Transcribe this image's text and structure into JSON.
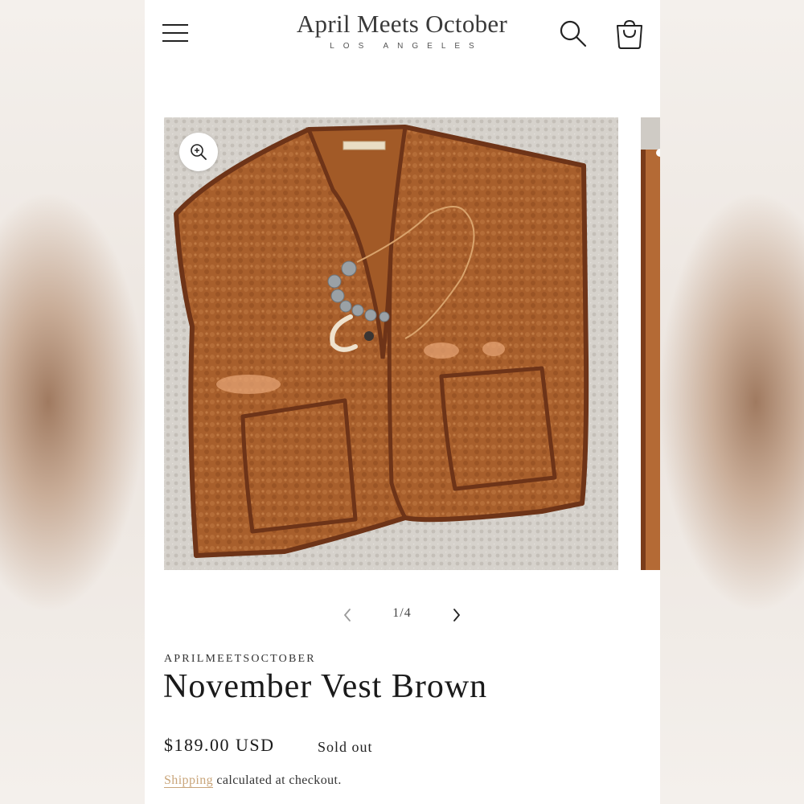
{
  "header": {
    "logo_title": "April Meets October",
    "logo_subtitle": "LOS ANGELES",
    "icons": [
      "menu-icon",
      "search-icon",
      "cart-icon"
    ]
  },
  "gallery": {
    "current": 1,
    "total": 4,
    "counter": "1/4",
    "icons": [
      "zoom-in-icon",
      "chevron-left-icon",
      "chevron-right-icon"
    ]
  },
  "product": {
    "vendor": "APRILMEETSOCTOBER",
    "title": "November Vest Brown",
    "price": "$189.00 USD",
    "availability": "Sold out",
    "shipping_link": "Shipping",
    "shipping_rest": " calculated at checkout."
  },
  "colors": {
    "accent_link": "#c9a57a",
    "vest_brown": "#a85f2c",
    "trim_brown": "#6e3418"
  }
}
